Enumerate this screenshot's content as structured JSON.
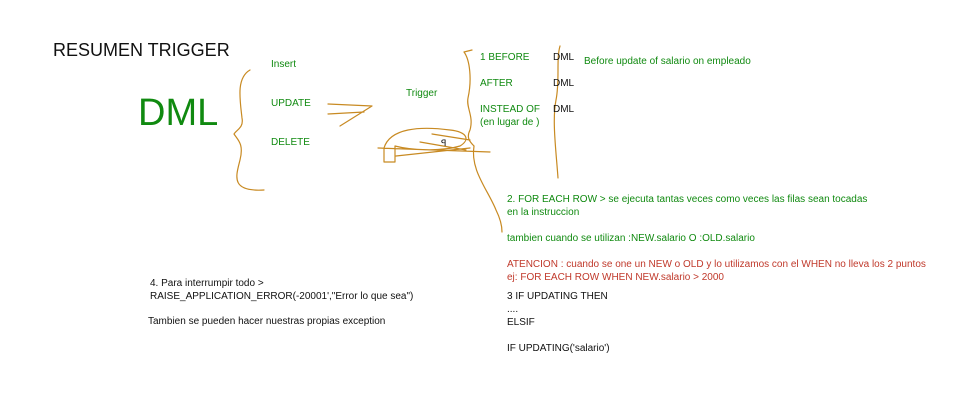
{
  "title": "RESUMEN TRIGGER",
  "dml_big": "DML",
  "dml_ops": [
    "Insert",
    "UPDATE",
    "DELETE"
  ],
  "trigger_label": "Trigger",
  "cursor_mark": "ꟼ",
  "timing": {
    "before": "1 BEFORE",
    "after": "AFTER",
    "instead_of": "INSTEAD OF",
    "instead_note": "(en lugar de )",
    "dml": "DML",
    "before_note": "Before update of salario on empleado"
  },
  "for_each_row": {
    "line1": "2. FOR EACH ROW > se ejecuta tantas veces como veces las filas sean tocadas",
    "line2": "en la instruccion",
    "line3": "tambien cuando se utilizan :NEW.salario  O   :OLD.salario"
  },
  "atencion": {
    "line1": "ATENCION : cuando se one un NEW o OLD y lo utilizamos con el WHEN no lleva los  2 puntos",
    "line2": "ej: FOR EACH ROW WHEN NEW.salario > 2000"
  },
  "updating": {
    "line1": "3 IF UPDATING THEN",
    "line2": "....",
    "line3": "ELSIF",
    "line4": "IF UPDATING('salario')"
  },
  "interrumpir": {
    "line1": "4. Para interrumpir todo >",
    "line2": "RAISE_APPLICATION_ERROR(-20001',\"Error lo que sea\")",
    "line3": "Tambien se pueden hacer nuestras propias exception"
  },
  "colors": {
    "green": "#108a10",
    "black": "#111111",
    "red": "#c0392b",
    "ink": "#c88a22"
  }
}
